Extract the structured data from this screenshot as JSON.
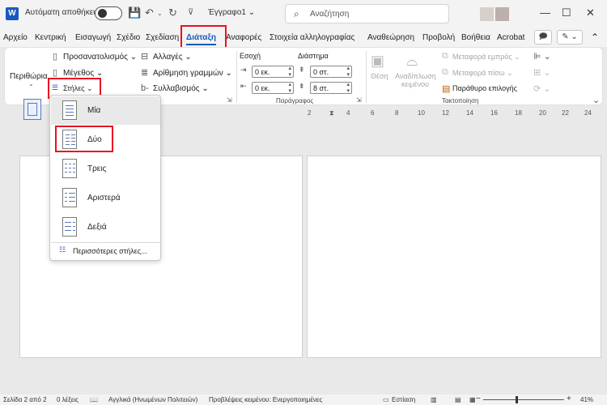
{
  "titlebar": {
    "autosave_label": "Αυτόματη αποθήκευση",
    "doc_title": "Έγγραφο1",
    "doc_title_caret": "⌄",
    "search_placeholder": "Αναζήτηση"
  },
  "tabs": [
    {
      "label": "Αρχείο"
    },
    {
      "label": "Κεντρική"
    },
    {
      "label": "Εισαγωγή"
    },
    {
      "label": "Σχέδιο"
    },
    {
      "label": "Σχεδίαση"
    },
    {
      "label": "Διάταξη"
    },
    {
      "label": "Αναφορές"
    },
    {
      "label": "Στοιχεία αλληλογραφίας"
    },
    {
      "label": "Αναθεώρηση"
    },
    {
      "label": "Προβολή"
    },
    {
      "label": "Βοήθεια"
    },
    {
      "label": "Acrobat"
    }
  ],
  "ribbon": {
    "margins": "Περιθώρια",
    "orientation": "Προσανατολισμός",
    "size": "Μέγεθος",
    "columns": "Στήλες",
    "breaks": "Αλλαγές",
    "line_numbers": "Αρίθμηση γραμμών",
    "hyphenation": "Συλλαβισμός",
    "indent": "Εσοχή",
    "spacing": "Διάστημα",
    "indent_left": "0 εκ.",
    "indent_right": "0 εκ.",
    "spacing_before": "0 στ.",
    "spacing_after": "8 στ.",
    "paragraph_group": "Παράγραφος",
    "position": "Θέση",
    "wrap_text": "Αναδίπλωση κειμένου",
    "bring_forward": "Μεταφορά εμπρός",
    "send_backward": "Μεταφορά πίσω",
    "selection_pane": "Παράθυρο επιλογής",
    "arrange_group": "Τακτοποίηση"
  },
  "columns_menu": {
    "items": [
      {
        "label": "Μία"
      },
      {
        "label": "Δύο"
      },
      {
        "label": "Τρεις"
      },
      {
        "label": "Αριστερά"
      },
      {
        "label": "Δεξιά"
      }
    ],
    "selected_index": 0,
    "more": "Περισσότερες στήλες..."
  },
  "ruler": [
    "2",
    "4",
    "6",
    "8",
    "10",
    "12",
    "14",
    "16",
    "18",
    "20",
    "22",
    "24"
  ],
  "statusbar": {
    "page": "Σελίδα 2 από 2",
    "words": "0 λέξεις",
    "language": "Αγγλικά (Ηνωμένων Πολιτειών)",
    "predictions": "Προβλέψεις κειμένου: Ενεργοποιημένες",
    "focus": "Εστίαση",
    "zoom": "41%"
  },
  "colors": {
    "accent": "#185abd",
    "highlight": "#e81123"
  }
}
